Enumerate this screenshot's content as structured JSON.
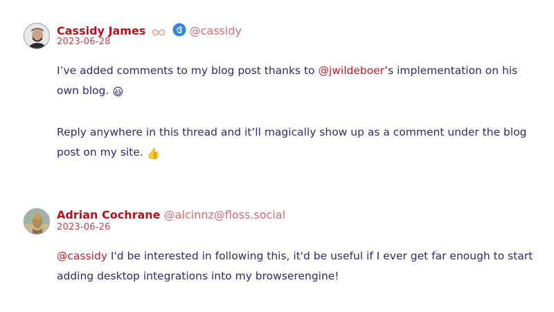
{
  "comments": [
    {
      "author": "Cassidy James",
      "handle": "@cassidy",
      "date": "2023-06-28",
      "mention": "@jwildeboer",
      "line1_before": "I’ve added comments to my blog post thanks to ",
      "line1_after": "’s implementation on his own blog. ",
      "emoji1": "😃",
      "para2": "Reply anywhere in this thread and it’ll magically show up as a comment under the blog post on my site. ",
      "emoji2": "👍",
      "icons": [
        "infinity-icon",
        "verified-badge-icon"
      ]
    },
    {
      "author": "Adrian Cochrane",
      "handle": "@alcinnz@floss.social",
      "date": "2023-06-26",
      "mention": "@cassidy",
      "text": " I'd be interested in following this, it'd be useful if I ever get far enough to start adding desktop integrations into my browserengine!"
    }
  ],
  "colors": {
    "author": "#b5121b",
    "handle": "#d66b72",
    "date": "#c9414a",
    "body": "#2d2a6e",
    "mention": "#c21d26"
  }
}
